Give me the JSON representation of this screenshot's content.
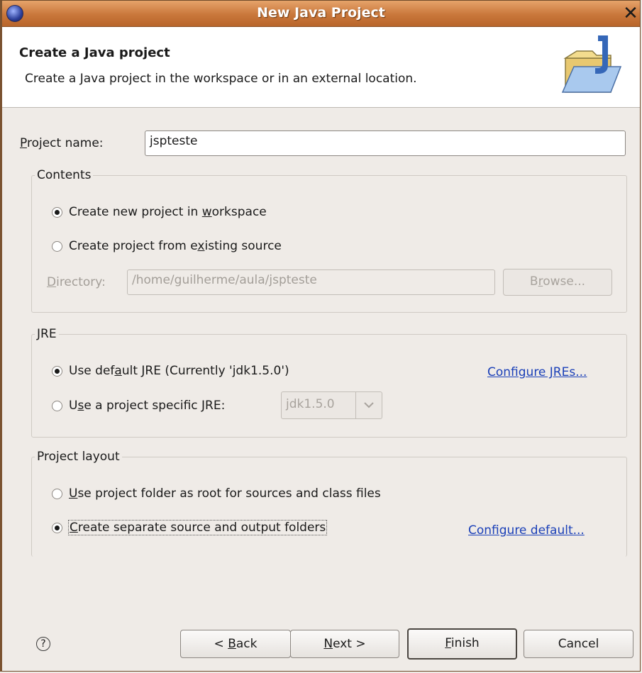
{
  "window": {
    "title": "New Java Project"
  },
  "banner": {
    "title": "Create a Java project",
    "description": "Create a Java project in the workspace or in an external location."
  },
  "project_name": {
    "label": "Project name:",
    "mnemonic": "P",
    "label_rest": "roject name:",
    "value": "jspteste"
  },
  "contents": {
    "legend": "Contents",
    "option_new": {
      "before": "Create new project in ",
      "mnemonic": "w",
      "after": "orkspace",
      "selected": true
    },
    "option_existing": {
      "before": "Create project from e",
      "mnemonic": "x",
      "after": "isting source",
      "selected": false
    },
    "directory_label": {
      "mnemonic": "D",
      "rest": "irectory:"
    },
    "directory_value": "/home/guilherme/aula/jspteste",
    "browse": {
      "before": "B",
      "mnemonic": "r",
      "after": "owse..."
    }
  },
  "jre": {
    "legend": "JRE",
    "option_default": {
      "before": "Use def",
      "mnemonic": "a",
      "after": "ult JRE (Currently 'jdk1.5.0')",
      "selected": true
    },
    "option_specific": {
      "before": "U",
      "mnemonic": "s",
      "after": "e a project specific JRE:",
      "selected": false
    },
    "specific_value": "jdk1.5.0",
    "configure_link": "Configure JREs..."
  },
  "layout": {
    "legend": "Project layout",
    "option_root": {
      "before": "",
      "mnemonic": "U",
      "after": "se project folder as root for sources and class files",
      "selected": false
    },
    "option_separate": {
      "before": "",
      "mnemonic": "C",
      "after": "reate separate source and output folders",
      "selected": true
    },
    "configure_link": "Configure default..."
  },
  "footer": {
    "help_icon": "question-circle-icon",
    "back": {
      "before": "< ",
      "mnemonic": "B",
      "after": "ack"
    },
    "next": {
      "before": "",
      "mnemonic": "N",
      "after": "ext >"
    },
    "finish": {
      "before": "",
      "mnemonic": "F",
      "after": "inish"
    },
    "cancel": "Cancel"
  },
  "colors": {
    "title_bar": "#c9773b",
    "link": "#1b40b8",
    "dialog_bg": "#efebe7"
  }
}
